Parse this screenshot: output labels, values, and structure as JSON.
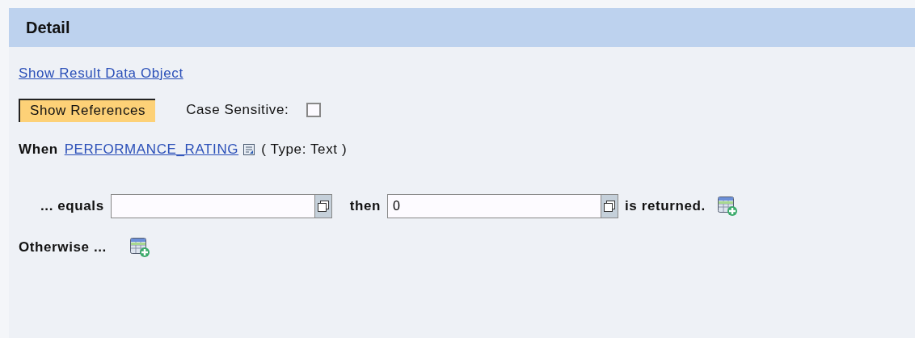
{
  "panel": {
    "title": "Detail"
  },
  "result_link": "Show Result Data Object",
  "references_button": "Show References",
  "case_sensitive": {
    "label": "Case Sensitive:",
    "checked": false
  },
  "when": {
    "label": "When",
    "field_link": "PERFORMANCE_RATING",
    "type_text": "( Type: Text )"
  },
  "condition": {
    "equals_label": "... equals",
    "then_label": "then",
    "then_value": "0",
    "returned_label": "is returned."
  },
  "otherwise_label": "Otherwise ..."
}
